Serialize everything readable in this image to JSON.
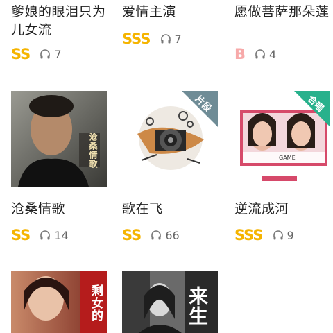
{
  "colors": {
    "grade_gold": "#f5b400",
    "grade_pink": "#f7a9a9",
    "tag_slate": "#6f8c96",
    "tag_green": "#28b18c"
  },
  "icons": {
    "listen": "headphones-icon"
  },
  "songs": [
    {
      "title": "爹娘的眼泪只为儿女流",
      "grade": "SS",
      "plays": "7"
    },
    {
      "title": "爱情主演",
      "grade": "SSS",
      "plays": "7"
    },
    {
      "title": "愿做菩萨那朵莲",
      "grade": "B",
      "plays": "4"
    },
    {
      "title": "沧桑情歌",
      "grade": "SS",
      "plays": "14",
      "cover_text": "沧桑情歌"
    },
    {
      "title": "歌在飞",
      "grade": "SS",
      "plays": "66",
      "tag": "片段"
    },
    {
      "title": "逆流成河",
      "grade": "SSS",
      "plays": "9",
      "tag": "合唱",
      "cover_text": "GAME"
    },
    {
      "title": "",
      "cover_text": "剩女的"
    },
    {
      "title": "",
      "cover_text": "来生"
    }
  ]
}
